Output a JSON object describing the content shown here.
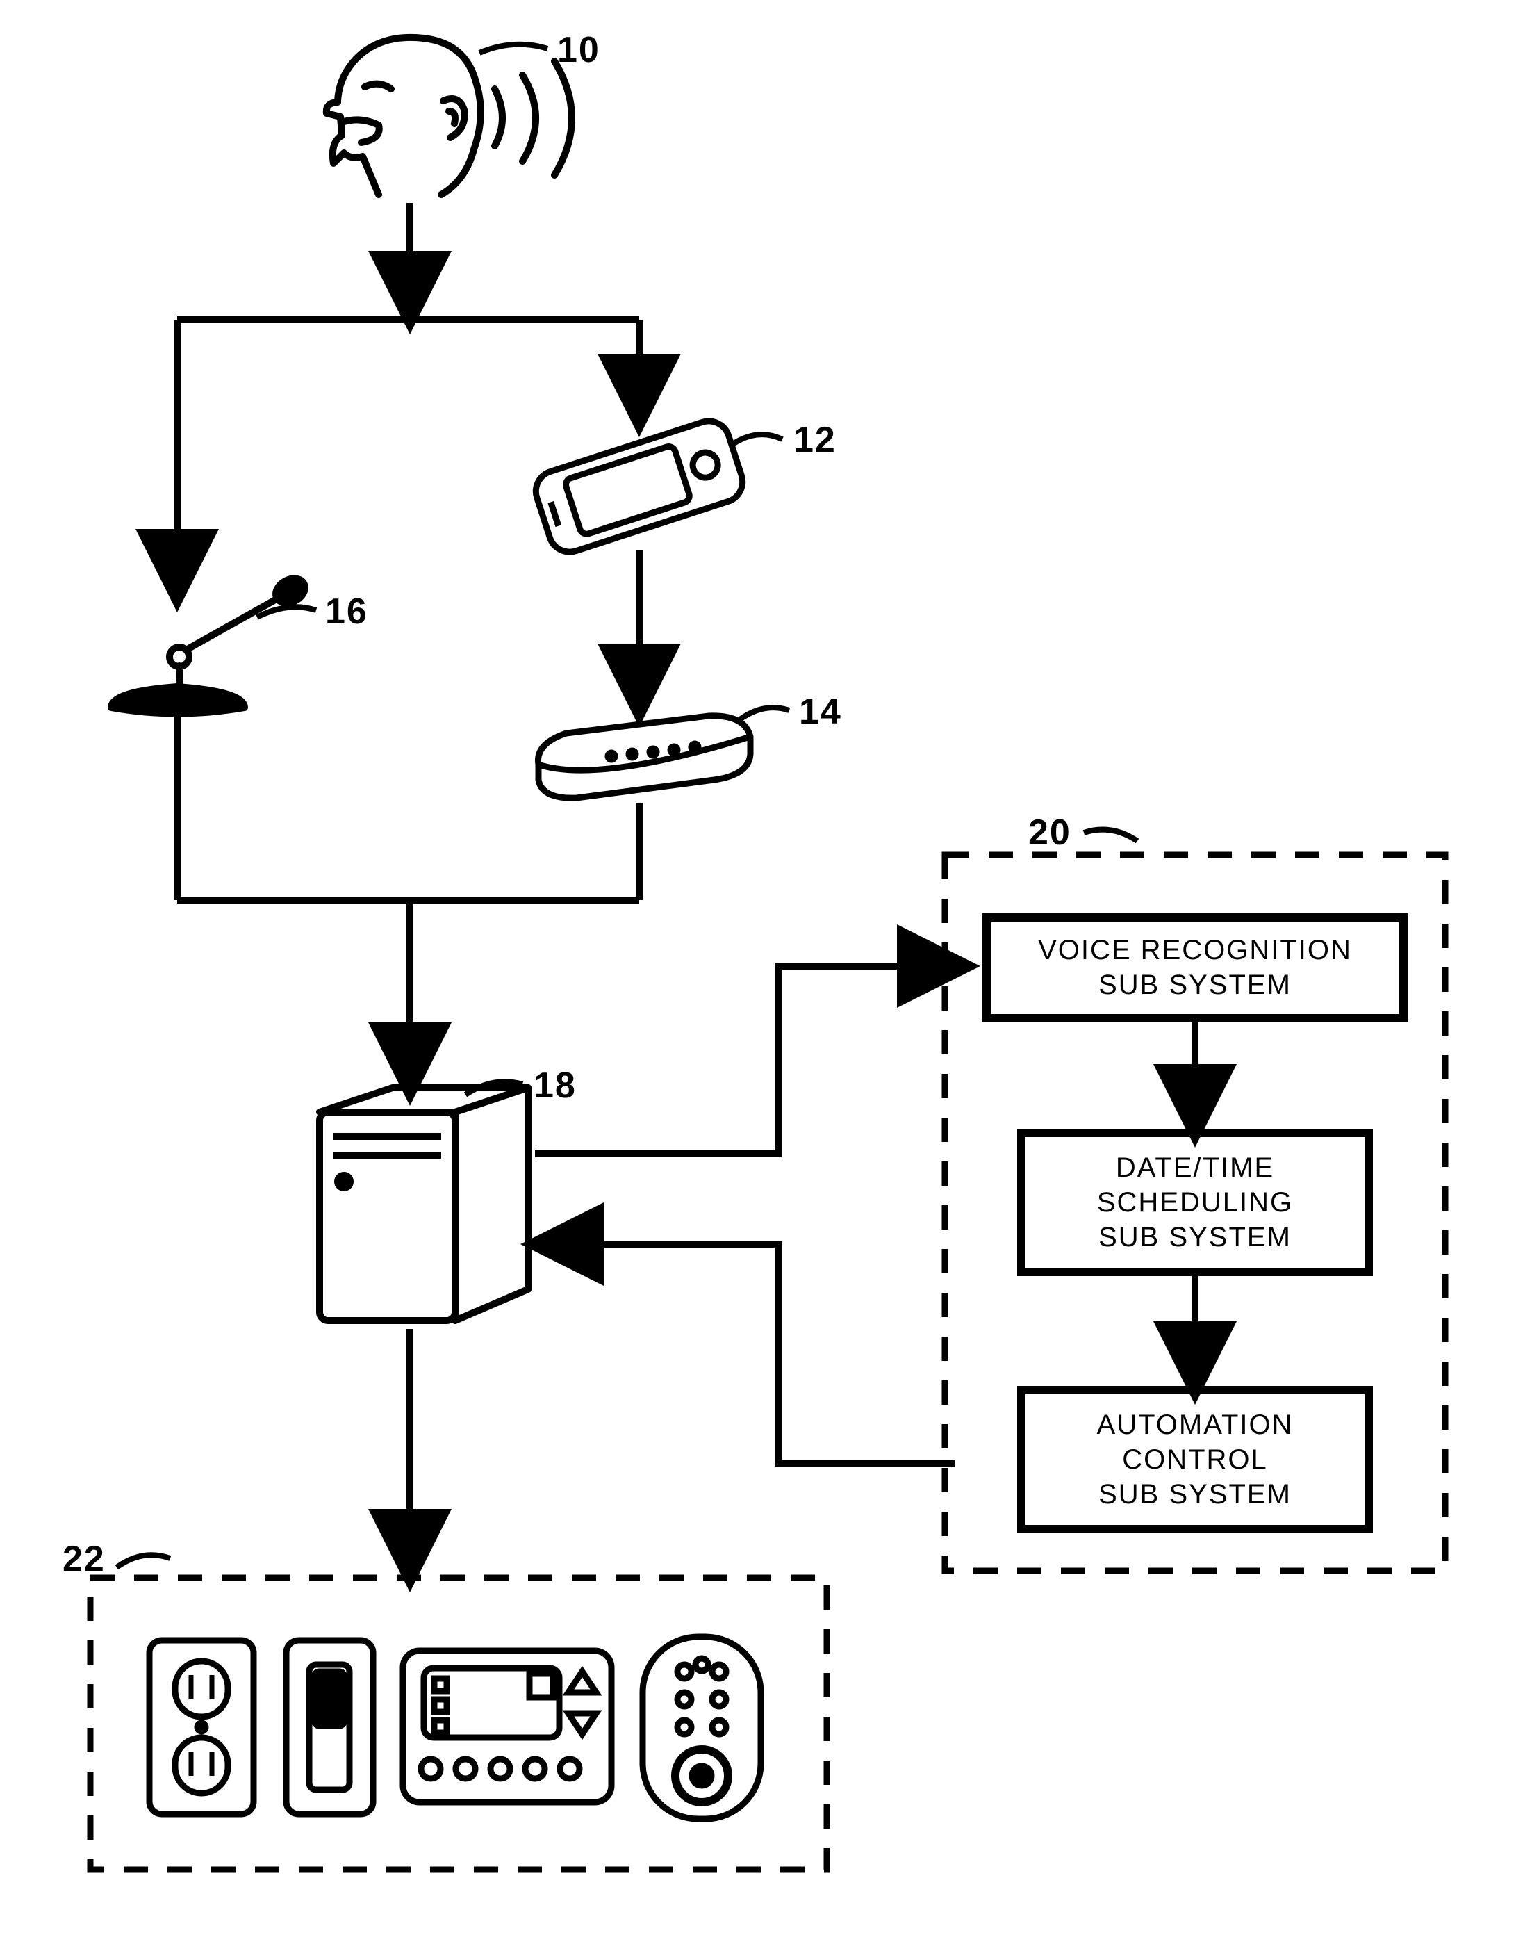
{
  "labels": {
    "speaker": "10",
    "phone": "12",
    "router": "14",
    "mic": "16",
    "server": "18",
    "software": "20",
    "devices": "22"
  },
  "blocks": {
    "voice_rec_l1": "VOICE RECOGNITION",
    "voice_rec_l2": "SUB SYSTEM",
    "scheduling_l1": "DATE/TIME",
    "scheduling_l2": "SCHEDULING",
    "scheduling_l3": "SUB SYSTEM",
    "automation_l1": "AUTOMATION",
    "automation_l2": "CONTROL",
    "automation_l3": "SUB SYSTEM"
  }
}
